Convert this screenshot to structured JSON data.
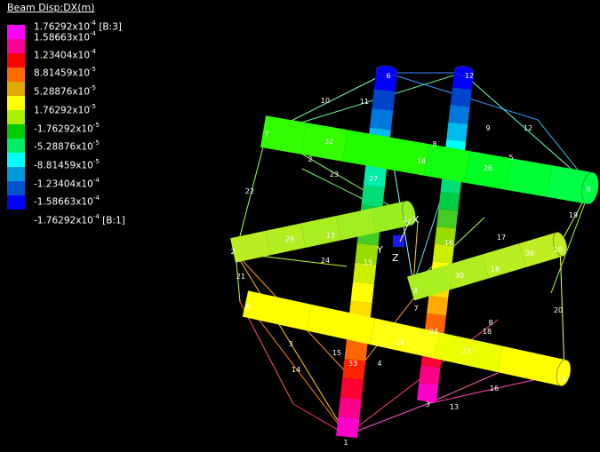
{
  "legend": {
    "title": "Beam Disp:DX(m)",
    "entries": [
      {
        "mant": "1.76292",
        "exp": "-4",
        "tag": " [B:3]"
      },
      {
        "mant": "1.58663",
        "exp": "-4",
        "tag": ""
      },
      {
        "mant": "1.23404",
        "exp": "-4",
        "tag": ""
      },
      {
        "mant": "8.81459",
        "exp": "-5",
        "tag": ""
      },
      {
        "mant": "5.28876",
        "exp": "-5",
        "tag": ""
      },
      {
        "mant": "1.76292",
        "exp": "-5",
        "tag": ""
      },
      {
        "mant": "-1.76292",
        "exp": "-5",
        "tag": ""
      },
      {
        "mant": "-5.28876",
        "exp": "-5",
        "tag": ""
      },
      {
        "mant": "-8.81459",
        "exp": "-5",
        "tag": ""
      },
      {
        "mant": "-1.23404",
        "exp": "-4",
        "tag": ""
      },
      {
        "mant": "-1.58663",
        "exp": "-4",
        "tag": ""
      },
      {
        "mant": "-1.76292",
        "exp": "-4",
        "tag": " [B:1]"
      }
    ],
    "times_sign": "x10",
    "colors": [
      "#ff00ff",
      "#ff0099",
      "#ff0000",
      "#ff6a00",
      "#e0aa00",
      "#ffff00",
      "#aaee00",
      "#00cc00",
      "#00ee66",
      "#00ffff",
      "#0099dd",
      "#0055cc",
      "#0000ff"
    ]
  },
  "axes": {
    "x_label": "X",
    "y_label": "Y",
    "z_label": "Z"
  },
  "node_labels": [
    "1",
    "2",
    "3",
    "4",
    "5",
    "6",
    "7",
    "8",
    "9",
    "10",
    "11",
    "12",
    "13",
    "14",
    "15",
    "16",
    "17",
    "18",
    "19",
    "20",
    "21",
    "22",
    "23",
    "24",
    "25",
    "26",
    "27",
    "28",
    "29",
    "30",
    "31",
    "32",
    "33",
    "34",
    "36"
  ]
}
